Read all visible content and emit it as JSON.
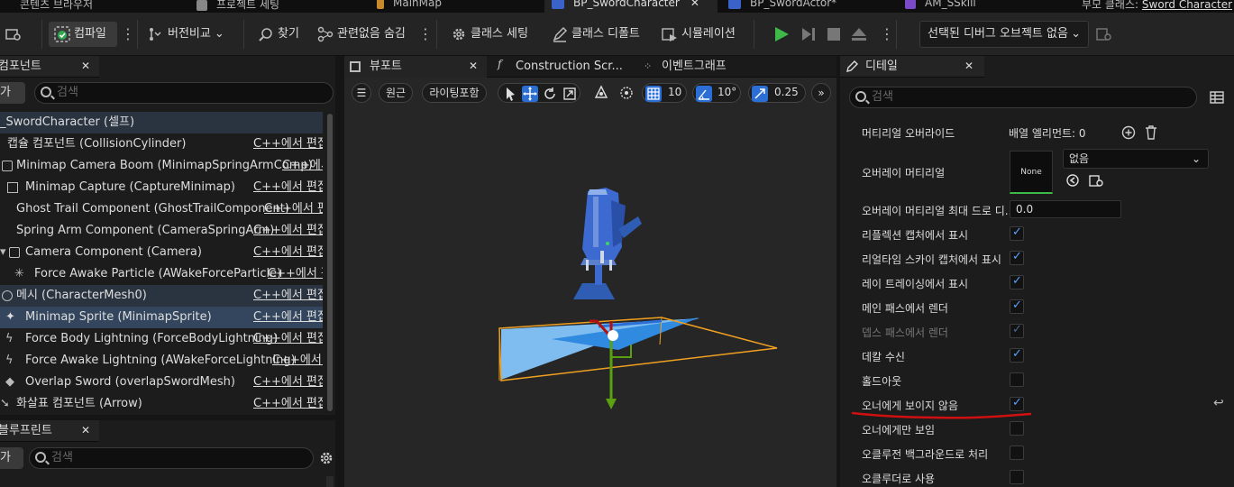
{
  "top_tabs": {
    "content_browser": "콘텐츠 브라우저",
    "project_settings": "프로젝트 세팅",
    "main_map": "MainMap",
    "bp_sword_character": "BP_SwordCharacter",
    "bp_sword_actor": "BP_SwordActor*",
    "am_sskill": "AM_SSkill",
    "parent_class_label": "부모 클래스:",
    "parent_class_value": "Sword Character"
  },
  "toolbar": {
    "compile": "컴파일",
    "version_compare": "버전비교",
    "find": "찾기",
    "hide_unrelated": "관련없음 숨김",
    "class_settings": "클래스 세팅",
    "class_defaults": "클래스 디폴트",
    "simulation": "시뮬레이션",
    "debug_object": "선택된 디버그 오브젝트 없음"
  },
  "components_panel": {
    "title": "컴포넌트",
    "add_button": "가",
    "search_placeholder": "검색",
    "root": "_SwordCharacter (셀프)",
    "items": [
      {
        "label": "캡슐 컴포넌트 (CollisionCylinder)",
        "edit": "C++에서 편집"
      },
      {
        "label": "Minimap Camera Boom (MinimapSpringArmComp)",
        "edit": "C++에서"
      },
      {
        "label": "Minimap Capture (CaptureMinimap)",
        "edit": "C++에서 편집"
      },
      {
        "label": "Ghost Trail Component (GhostTrailComponent)",
        "edit": "C++에서 편집"
      },
      {
        "label": "Spring Arm Component (CameraSpringArm)",
        "edit": "C++에서 편집"
      },
      {
        "label": "Camera Component (Camera)",
        "edit": "C++에서 편집"
      },
      {
        "label": "Force Awake Particle (AWakeForceParticle)",
        "edit": "C++에서 편"
      },
      {
        "label": "메시 (CharacterMesh0)",
        "edit": "C++에서 편집"
      },
      {
        "label": "Minimap Sprite (MinimapSprite)",
        "edit": "C++에서 편집"
      },
      {
        "label": "Force Body Lightning (ForceBodyLightning)",
        "edit": "C++에서 편집"
      },
      {
        "label": "Force Awake Lightning (AWakeForceLightning)",
        "edit": "C++에서 편"
      },
      {
        "label": "Overlap Sword (overlapSwordMesh)",
        "edit": "C++에서 편집"
      },
      {
        "label": "화살표 컴포넌트 (Arrow)",
        "edit": "C++에서 편집"
      }
    ]
  },
  "blueprint_panel": {
    "title": "블루프린트",
    "add_button": "가",
    "search_placeholder": "검색"
  },
  "viewport_panel": {
    "tabs": {
      "viewport": "뷰포트",
      "construction": "Construction Scr...",
      "event_graph": "이벤트그래프"
    },
    "perspective": "원근",
    "lit": "라이팅포함",
    "grid_snap": "10",
    "rotation_snap": "10°",
    "scale_snap": "0.25"
  },
  "details_panel": {
    "title": "디테일",
    "search_placeholder": "검색",
    "material_override_label": "머티리얼 오버라이드",
    "array_elements": "배열 엘리먼트: 0",
    "overlay_material_label": "오버레이 머티리얼",
    "overlay_thumb": "None",
    "overlay_value": "없음",
    "overlay_max_draw_label": "오버레이 머티리얼 최대 드로 디...",
    "overlay_max_draw_value": "0.0",
    "bool_rows": [
      {
        "label": "리플렉션 캡처에서 표시",
        "checked": true,
        "dim": false
      },
      {
        "label": "리얼타임 스카이 캡처에서 표시",
        "checked": true,
        "dim": false
      },
      {
        "label": "레이 트레이싱에서 표시",
        "checked": true,
        "dim": false
      },
      {
        "label": "메인 패스에서 렌더",
        "checked": true,
        "dim": false
      },
      {
        "label": "뎁스 패스에서 렌더",
        "checked": true,
        "dim": true
      },
      {
        "label": "데칼 수신",
        "checked": true,
        "dim": false
      },
      {
        "label": "홀드아웃",
        "checked": false,
        "dim": false
      },
      {
        "label": "오너에게 보이지 않음",
        "checked": true,
        "dim": false
      },
      {
        "label": "오너에게만 보임",
        "checked": false,
        "dim": false
      },
      {
        "label": "오클루전 백그라운드로 처리",
        "checked": false,
        "dim": false
      },
      {
        "label": "오클루더로 사용",
        "checked": false,
        "dim": false
      }
    ],
    "accent_color": "#5aa0ff",
    "annotation_color": "#d01010"
  }
}
